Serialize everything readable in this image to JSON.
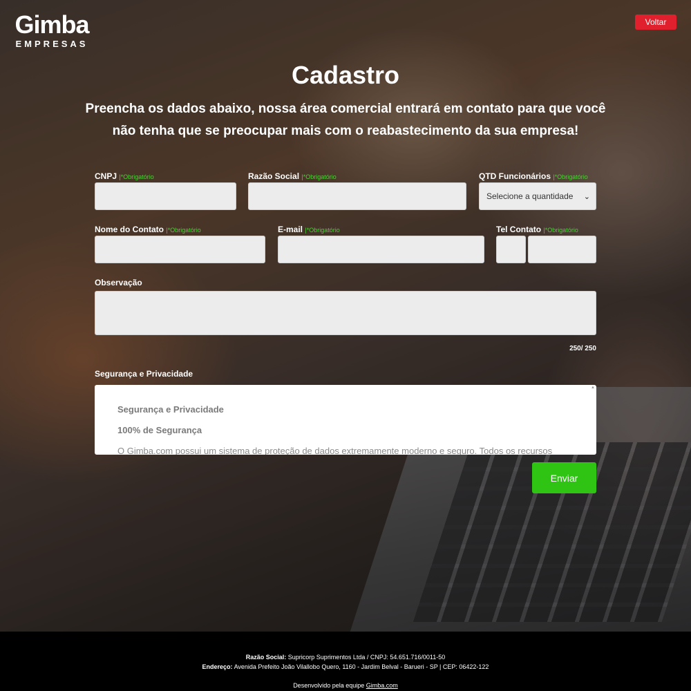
{
  "logo": {
    "main": "Gimba",
    "sub": "EMPRESAS"
  },
  "header": {
    "back_label": "Voltar"
  },
  "hero": {
    "title": "Cadastro",
    "subtitle": "Preencha os dados abaixo, nossa área comercial entrará em contato para que você não tenha que se preocupar mais com o reabastecimento da sua empresa!"
  },
  "form": {
    "required_text": "*Obrigatório",
    "separator": "|",
    "cnpj": {
      "label": "CNPJ",
      "value": ""
    },
    "razao_social": {
      "label": "Razão Social",
      "value": ""
    },
    "qtd_funcionarios": {
      "label": "QTD Funcionários",
      "selected": "Selecione a quantidade"
    },
    "nome_contato": {
      "label": "Nome do Contato",
      "value": ""
    },
    "email": {
      "label": "E-mail",
      "value": ""
    },
    "tel_contato": {
      "label": "Tel Contato",
      "ddd": "",
      "number": ""
    },
    "observacao": {
      "label": "Observação",
      "value": "",
      "counter": "250/ 250"
    },
    "privacy": {
      "label": "Segurança e Privacidade",
      "box_title": "Segurança e Privacidade",
      "box_subtitle": "100% de Segurança",
      "box_text": "O Gimba.com possui um sistema de proteção de dados extremamente moderno e seguro. Todos os recursos"
    },
    "submit_label": "Enviar"
  },
  "footer": {
    "razao_label": "Razão Social:",
    "razao_value": "Supricorp Suprimentos Ltda / CNPJ: 54.651.716/0011-50",
    "endereco_label": "Endereço:",
    "endereco_value": "Avenida Prefeito João Vilallobo Quero, 1160 - Jardim Belval - Barueri - SP | CEP: 06422-122",
    "dev_text": "Desenvolvido pela equipe",
    "dev_link": "Gimba.com"
  },
  "colors": {
    "accent_red": "#e0212d",
    "accent_green": "#2fc414",
    "required_green": "#4cd137"
  }
}
